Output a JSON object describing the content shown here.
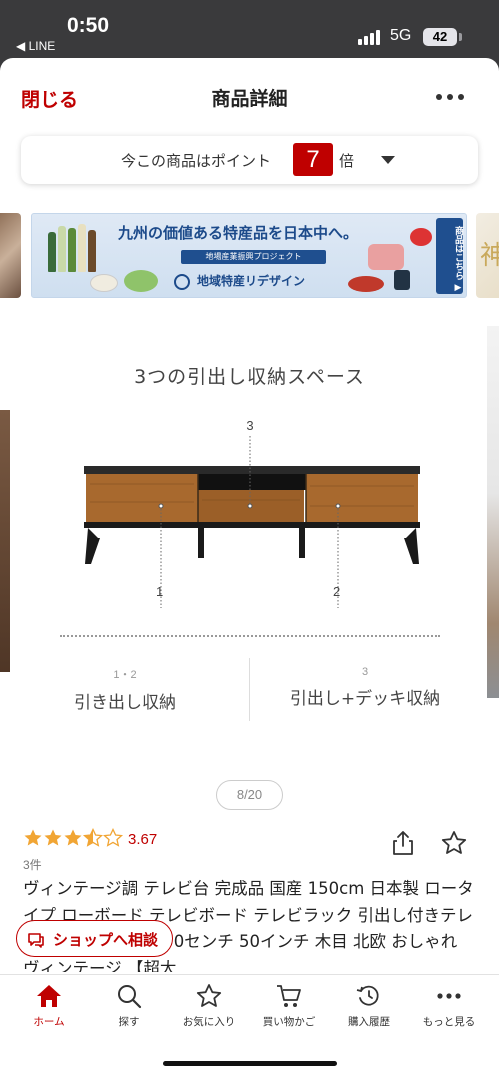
{
  "status_bar": {
    "time": "0:50",
    "back_app": "◀ LINE",
    "network": "5G",
    "battery": "42"
  },
  "header": {
    "close_label": "閉じる",
    "title": "商品詳細"
  },
  "points": {
    "prefix": "今この商品はポイント",
    "multiplier": "7",
    "suffix": "倍"
  },
  "banner": {
    "headline": "九州の価値ある特産品を日本中へ。",
    "sub": "地場産業振興プロジェクト",
    "brand": "地域特産リデザイン",
    "cta": "商品はこちら ▶"
  },
  "product_image": {
    "caption": "3つの引出し収納スペース",
    "callouts": [
      "3",
      "1",
      "2"
    ],
    "features": [
      {
        "nums": "1・2",
        "label": "引き出し収納"
      },
      {
        "nums": "3",
        "label": "引出し+デッキ収納"
      }
    ],
    "pager": "8/20"
  },
  "product": {
    "rating": "3.67",
    "rating_value": 3.5,
    "review_count": "3件",
    "title": "ヴィンテージ調 テレビ台 完成品 国産 150cm 日本製 ロータイプ ローボード テレビボード テレビラック 引出し付きテレビ台 木目調 150 150センチ 50インチ 木目 北欧 おしゃれ ヴィンテージ 【超大"
  },
  "consult_button": "ショップへ相談",
  "tabbar": [
    {
      "icon": "home-icon",
      "label": "ホーム",
      "active": true
    },
    {
      "icon": "search-icon",
      "label": "探す",
      "active": false
    },
    {
      "icon": "star-icon",
      "label": "お気に入り",
      "active": false
    },
    {
      "icon": "cart-icon",
      "label": "買い物かご",
      "active": false
    },
    {
      "icon": "history-icon",
      "label": "購入履歴",
      "active": false
    },
    {
      "icon": "more-icon",
      "label": "もっと見る",
      "active": false
    }
  ],
  "colors": {
    "brand_red": "#bf0000",
    "star": "#f1a534",
    "banner_blue": "#1f4f8f"
  }
}
